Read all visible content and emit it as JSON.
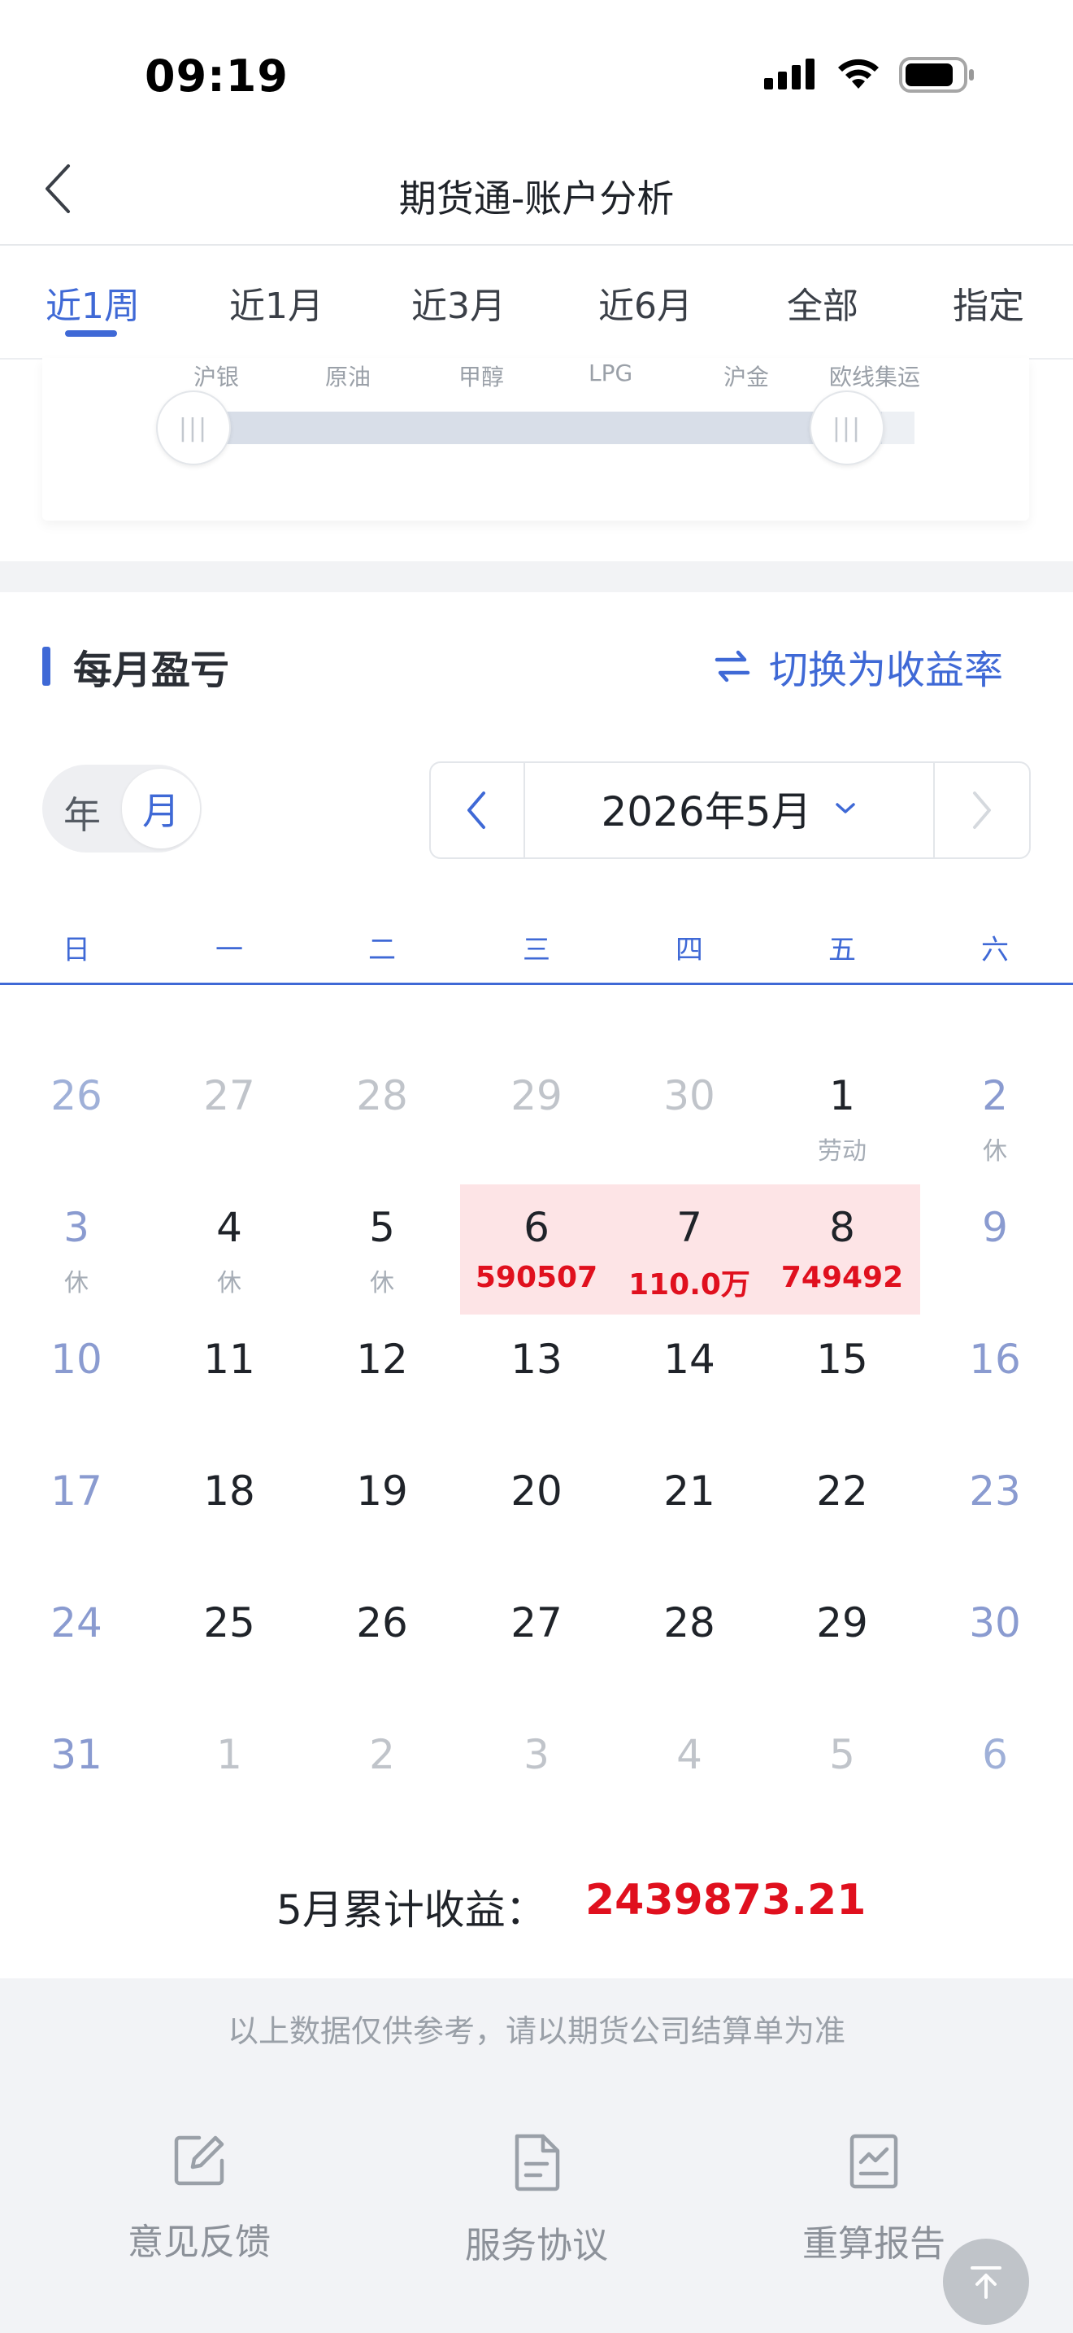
{
  "status_bar": {
    "time": "09:19"
  },
  "nav": {
    "title": "期货通-账户分析"
  },
  "period_tabs": [
    {
      "label": "近1周",
      "active": true
    },
    {
      "label": "近1月",
      "active": false
    },
    {
      "label": "近3月",
      "active": false
    },
    {
      "label": "近6月",
      "active": false
    },
    {
      "label": "全部",
      "active": false
    },
    {
      "label": "指定",
      "active": false
    }
  ],
  "slider": {
    "labels": [
      "沪银",
      "原油",
      "甲醇",
      "LPG",
      "沪金",
      "欧线集运"
    ]
  },
  "section": {
    "title": "每月盈亏",
    "switch_label": "切换为收益率"
  },
  "toggle": {
    "year_label": "年",
    "month_label": "月",
    "selected": "月"
  },
  "month_selector": {
    "label": "2026年5月"
  },
  "weekdays": [
    "日",
    "一",
    "二",
    "三",
    "四",
    "五",
    "六"
  ],
  "calendar": {
    "rows": [
      [
        {
          "day": "26",
          "kind": "other-we"
        },
        {
          "day": "27",
          "kind": "other"
        },
        {
          "day": "28",
          "kind": "other"
        },
        {
          "day": "29",
          "kind": "other"
        },
        {
          "day": "30",
          "kind": "other"
        },
        {
          "day": "1",
          "kind": "cur",
          "sub": "劳动"
        },
        {
          "day": "2",
          "kind": "weekend",
          "sub": "休"
        }
      ],
      [
        {
          "day": "3",
          "kind": "weekend",
          "sub": "休"
        },
        {
          "day": "4",
          "kind": "cur",
          "sub": "休"
        },
        {
          "day": "5",
          "kind": "cur",
          "sub": "休"
        },
        {
          "day": "6",
          "kind": "cur",
          "profit": "590507"
        },
        {
          "day": "7",
          "kind": "cur",
          "profit": "110.0万"
        },
        {
          "day": "8",
          "kind": "cur",
          "profit": "749492"
        },
        {
          "day": "9",
          "kind": "weekend"
        }
      ],
      [
        {
          "day": "10",
          "kind": "weekend"
        },
        {
          "day": "11",
          "kind": "cur"
        },
        {
          "day": "12",
          "kind": "cur"
        },
        {
          "day": "13",
          "kind": "cur"
        },
        {
          "day": "14",
          "kind": "cur"
        },
        {
          "day": "15",
          "kind": "cur"
        },
        {
          "day": "16",
          "kind": "weekend"
        }
      ],
      [
        {
          "day": "17",
          "kind": "weekend"
        },
        {
          "day": "18",
          "kind": "cur"
        },
        {
          "day": "19",
          "kind": "cur"
        },
        {
          "day": "20",
          "kind": "cur"
        },
        {
          "day": "21",
          "kind": "cur"
        },
        {
          "day": "22",
          "kind": "cur"
        },
        {
          "day": "23",
          "kind": "weekend"
        }
      ],
      [
        {
          "day": "24",
          "kind": "weekend"
        },
        {
          "day": "25",
          "kind": "cur"
        },
        {
          "day": "26",
          "kind": "cur"
        },
        {
          "day": "27",
          "kind": "cur"
        },
        {
          "day": "28",
          "kind": "cur"
        },
        {
          "day": "29",
          "kind": "cur"
        },
        {
          "day": "30",
          "kind": "weekend"
        }
      ],
      [
        {
          "day": "31",
          "kind": "weekend"
        },
        {
          "day": "1",
          "kind": "other"
        },
        {
          "day": "2",
          "kind": "other"
        },
        {
          "day": "3",
          "kind": "other"
        },
        {
          "day": "4",
          "kind": "other"
        },
        {
          "day": "5",
          "kind": "other"
        },
        {
          "day": "6",
          "kind": "other-we"
        }
      ]
    ]
  },
  "summary": {
    "label": "5月累计收益：",
    "value": "2439873.21"
  },
  "footer": {
    "disclaimer": "以上数据仅供参考，请以期货公司结算单为准",
    "items": [
      {
        "label": "意见反馈",
        "icon": "edit-icon"
      },
      {
        "label": "服务协议",
        "icon": "document-icon"
      },
      {
        "label": "重算报告",
        "icon": "chart-report-icon"
      }
    ]
  },
  "colors": {
    "accent": "#3f69d6",
    "profit": "#e0101e",
    "highlight": "#fde4e6"
  }
}
